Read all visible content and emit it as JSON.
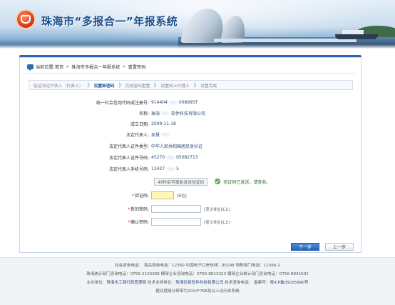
{
  "header": {
    "title": "珠海市“多报合一”年报系统"
  },
  "breadcrumb": {
    "prefix": "当前位置:",
    "items": [
      "首页",
      "珠海市多报合一年报系统",
      "重置密码"
    ],
    "sep": ">"
  },
  "steps": [
    "验证法定代表人（负责人）",
    "设置新密码",
    "完成密码重置",
    "设置网上代理人",
    "设置完成"
  ],
  "form": {
    "credit_code_label": "统一社会信用代码或注册号:",
    "credit_code_a": "914404",
    "credit_code_b": "00899ST",
    "name_label": "名称:",
    "name_a": "珠海",
    "name_b": "软件科技有限公司",
    "date_label": "成立日期:",
    "date_value": "2009-11-18",
    "rep_label": "法定代表人:",
    "rep_value": "吴慧",
    "cert_type_label": "法定代表人证件类型:",
    "cert_type_value": "中华人民共和国居民身份证",
    "cert_no_label": "法定代表人证件号码:",
    "cert_no_a": "45270",
    "cert_no_b": "05082713",
    "phone_label": "法定代表人手机号码:",
    "phone_a": "13427",
    "phone_b": "5",
    "sms_button": "46秒后可重新发送验证码",
    "sent_msg": "验证码已发送，请查收。",
    "code_label": "验证码:",
    "code_hint": "(6位)",
    "new_pwd_label": "新的密码:",
    "new_pwd_hint": "(至少8位以上)",
    "confirm_pwd_label": "确认密码:",
    "confirm_pwd_hint": "(至少8位以上)",
    "required_mark": "*"
  },
  "buttons": {
    "next": "下一步",
    "prev": "上一步"
  },
  "footer": {
    "line1": "社会咨询电话：  海关咨询电话：12360    中国电子口岸热线：95198    地税部门电话：12366-2",
    "line2": "珠海统计部门咨询电话：0756-2120366    横琴企业咨询电话：0756-8813323    横琴企业统计部门咨询电话：0756-8841631",
    "line3_prefix": "主办单位：",
    "line3_org": "珠海市工商行政管理局",
    "line3_mid": "    技术支持单位：",
    "line3_tech": "珠海优拓软件科技有限公司",
    "line3_tail": "    技术咨询电话：      备案号：",
    "line3_icp": "粤ICP备05025990号",
    "line4": "建议使用分辨率为1024*768及以上访问本系统"
  }
}
